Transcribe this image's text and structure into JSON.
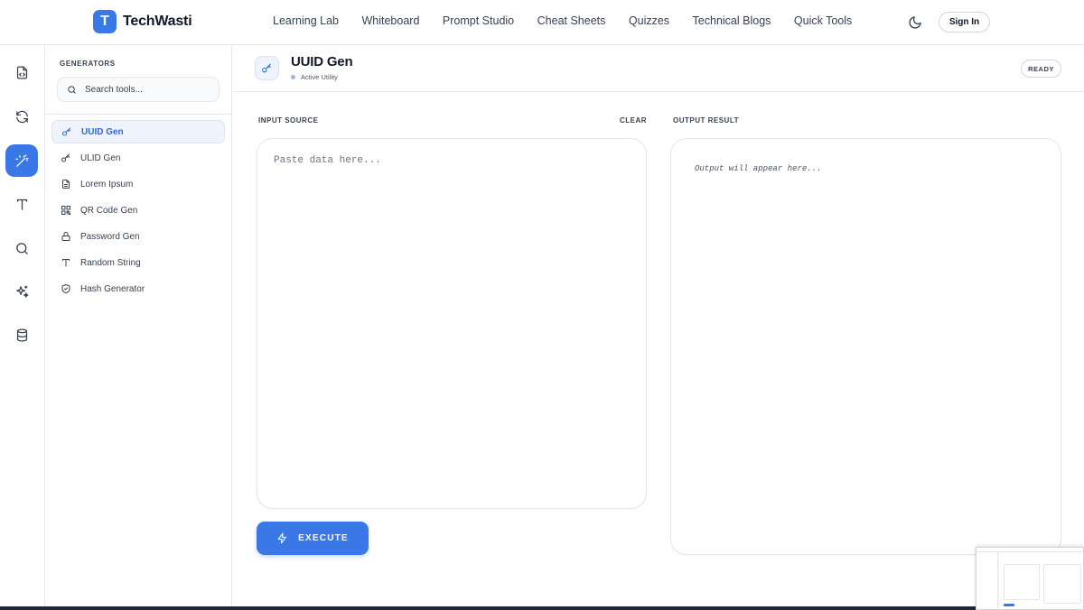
{
  "header": {
    "logo_letter": "T",
    "brand": "TechWasti",
    "nav": [
      "Learning Lab",
      "Whiteboard",
      "Prompt Studio",
      "Cheat Sheets",
      "Quizzes",
      "Technical Blogs",
      "Quick Tools"
    ],
    "sign_in": "Sign In"
  },
  "rail": {
    "items": [
      "file-code-icon",
      "refresh-icon",
      "magic-wand-icon",
      "type-icon",
      "search-icon",
      "sparkles-icon",
      "database-icon"
    ],
    "active_index": 2
  },
  "sidebar": {
    "heading": "GENERATORS",
    "search_placeholder": "Search tools...",
    "items": [
      {
        "label": "UUID Gen",
        "icon": "key-icon",
        "active": true
      },
      {
        "label": "ULID Gen",
        "icon": "key-icon",
        "active": false
      },
      {
        "label": "Lorem Ipsum",
        "icon": "document-icon",
        "active": false
      },
      {
        "label": "QR Code Gen",
        "icon": "qr-code-icon",
        "active": false
      },
      {
        "label": "Password Gen",
        "icon": "lock-icon",
        "active": false
      },
      {
        "label": "Random String",
        "icon": "type-icon",
        "active": false
      },
      {
        "label": "Hash Generator",
        "icon": "shield-icon",
        "active": false
      }
    ]
  },
  "tool": {
    "title": "UUID Gen",
    "status": "Active Utility",
    "badge": "READY"
  },
  "panels": {
    "input_label": "INPUT SOURCE",
    "clear_label": "CLEAR",
    "input_placeholder": "Paste data here...",
    "output_label": "OUTPUT RESULT",
    "output_placeholder": "Output will appear here...",
    "execute_label": "EXECUTE"
  },
  "colors": {
    "accent": "#3b78e7",
    "border": "#e5e7eb"
  }
}
